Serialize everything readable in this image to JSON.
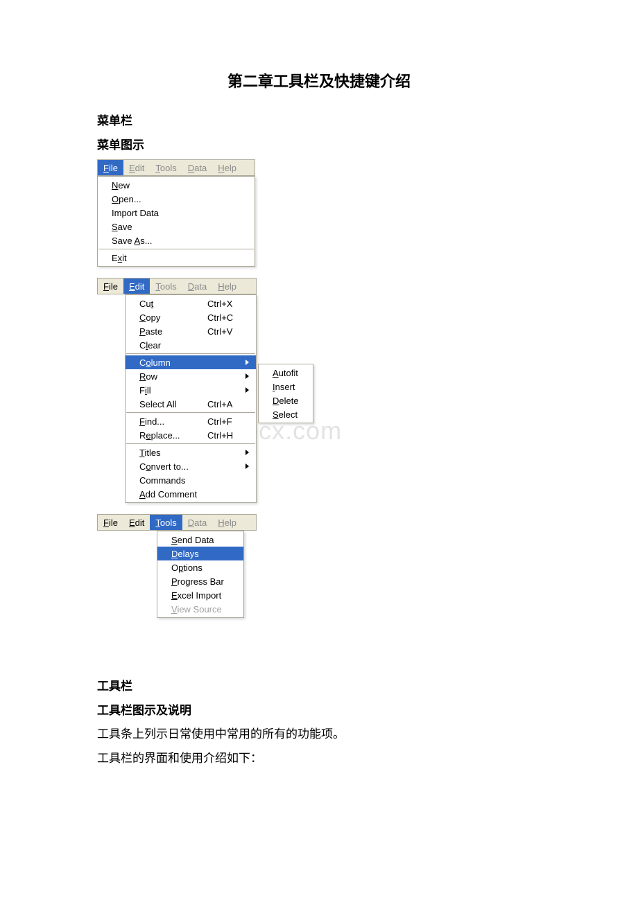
{
  "title": "第二章工具栏及快捷键介绍",
  "section_menu": "菜单栏",
  "section_menu_illus": "菜单图示",
  "section_toolbar": "工具栏",
  "section_toolbar_illus": "工具栏图示及说明",
  "para_toolbar_1": "工具条上列示日常使用中常用的所有的功能项。",
  "para_toolbar_2": "工具栏的界面和使用介绍如下：",
  "watermark": "www.bdocx.com",
  "menubar": {
    "file": {
      "hot": "F",
      "rest": "ile"
    },
    "edit": {
      "hot": "E",
      "rest": "dit"
    },
    "tools": {
      "hot": "T",
      "rest": "ools"
    },
    "data": {
      "hot": "D",
      "rest": "ata"
    },
    "help": {
      "hot": "H",
      "rest": "elp"
    }
  },
  "file_menu": {
    "new": {
      "hot": "N",
      "rest": "ew"
    },
    "open": {
      "hot": "O",
      "rest": "pen..."
    },
    "import": {
      "plain": "Import Data"
    },
    "save": {
      "hot": "S",
      "rest": "ave"
    },
    "saveas_pre": "Save ",
    "saveas_hot": "A",
    "saveas_post": "s...",
    "exit_pre": "E",
    "exit_hot": "x",
    "exit_post": "it"
  },
  "edit_menu": {
    "cut_pre": "Cu",
    "cut_hot": "t",
    "cut_short": "Ctrl+X",
    "copy_hot": "C",
    "copy_rest": "opy",
    "copy_short": "Ctrl+C",
    "paste_hot": "P",
    "paste_rest": "aste",
    "paste_short": "Ctrl+V",
    "clear_pre": "C",
    "clear_hot": "l",
    "clear_post": "ear",
    "column_pre": "C",
    "column_hot": "o",
    "column_post": "lumn",
    "row_hot": "R",
    "row_rest": "ow",
    "fill_pre": "F",
    "fill_hot": "i",
    "fill_post": "ll",
    "selectall": "Select All",
    "selectall_short": "Ctrl+A",
    "find_hot": "F",
    "find_rest": "ind...",
    "find_short": "Ctrl+F",
    "replace_pre": "R",
    "replace_hot": "e",
    "replace_post": "place...",
    "replace_short": "Ctrl+H",
    "titles_hot": "T",
    "titles_rest": "itles",
    "convert_pre": "C",
    "convert_hot": "o",
    "convert_post": "nvert to...",
    "commands": "Commands",
    "addcomment_hot": "A",
    "addcomment_rest": "dd Comment"
  },
  "submenu": {
    "autofit_hot": "A",
    "autofit_rest": "utofit",
    "insert_hot": "I",
    "insert_rest": "nsert",
    "delete_hot": "D",
    "delete_rest": "elete",
    "select_hot": "S",
    "select_rest": "elect"
  },
  "tools_menu": {
    "send_hot": "S",
    "send_rest": "end Data",
    "delays_hot": "D",
    "delays_rest": "elays",
    "options_pre": "O",
    "options_hot": "p",
    "options_post": "tions",
    "progress_hot": "P",
    "progress_rest": "rogress Bar",
    "excel_hot": "E",
    "excel_rest": "xcel Import",
    "view_hot": "V",
    "view_rest": "iew Source"
  }
}
